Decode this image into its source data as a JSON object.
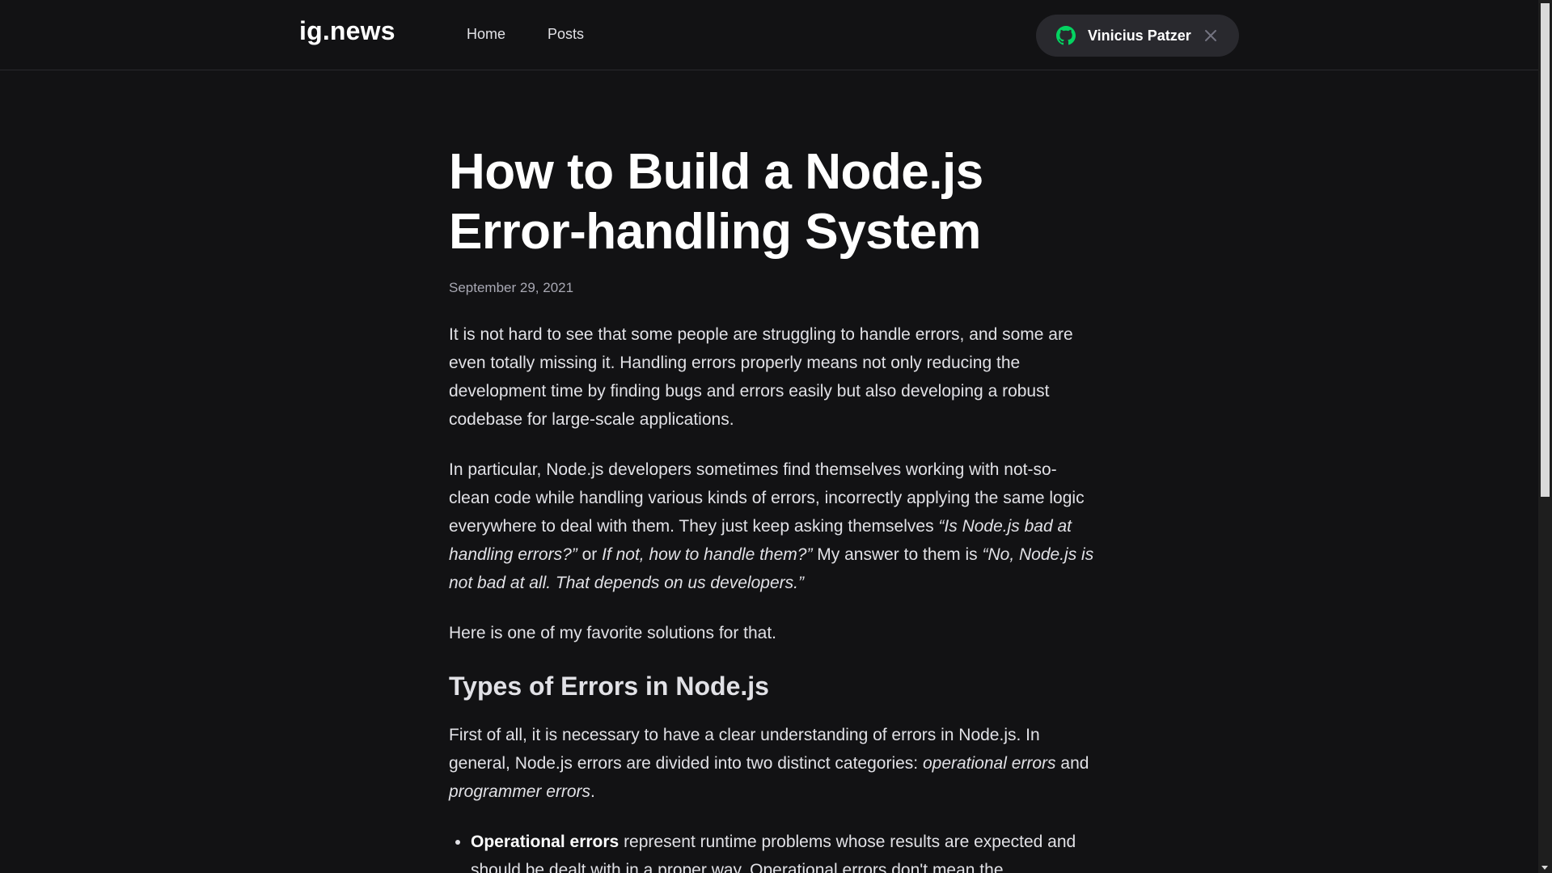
{
  "header": {
    "logo": "ig.news",
    "nav": [
      {
        "label": "Home"
      },
      {
        "label": "Posts"
      }
    ],
    "user": {
      "name": "Vinicius Patzer",
      "icon": "github-icon",
      "accent": "#04d361"
    }
  },
  "article": {
    "title": "How to Build a Node.js Error-handling System",
    "date": "September 29, 2021",
    "p1": "It is not hard to see that some people are struggling to handle errors, and some are even totally missing it. Handling errors properly means not only reducing the development time by finding bugs and errors easily but also developing a robust codebase for large-scale applications.",
    "p2": {
      "t1": "In particular, Node.js developers sometimes find themselves working with not-so-clean code while handling various kinds of errors, incorrectly applying the same logic everywhere to deal with them. They just keep asking themselves ",
      "q1": "“Is Node.js bad at handling errors?”",
      "t2": " or ",
      "q2": "If not, how to handle them?”",
      "t3": " My answer to them is ",
      "q3": "“No, Node.js is not bad at all. That depends on us developers.”"
    },
    "p3": "Here is one of my favorite solutions for that.",
    "h2": "Types of Errors in Node.js",
    "p4": {
      "t1": "First of all, it is necessary to have a clear understanding of errors in Node.js. In general, Node.js errors are divided into two distinct categories: ",
      "e1": "operational errors",
      "t2": " and ",
      "e2": "programmer errors",
      "t3": "."
    },
    "li1": {
      "strong": "Operational errors",
      "text": " represent runtime problems whose results are expected and should be dealt with in a proper way. Operational errors don't mean the"
    }
  }
}
